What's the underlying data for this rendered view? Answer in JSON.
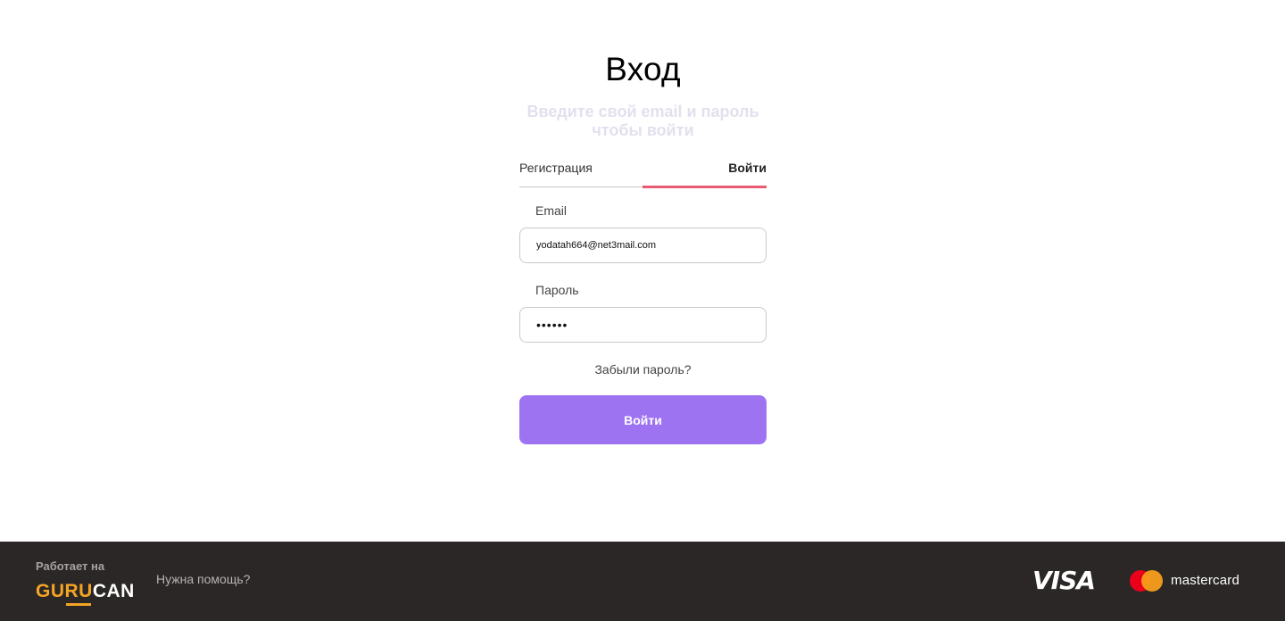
{
  "login": {
    "title": "Вход",
    "subtitle": "Введите свой email и пароль чтобы войти",
    "tabs": {
      "register": "Регистрация",
      "login": "Войти",
      "active": "login"
    },
    "email": {
      "label": "Email",
      "value": "yodatah664@net3mail.com"
    },
    "password": {
      "label": "Пароль",
      "value": "••••••"
    },
    "forgot_link": "Забыли пароль?",
    "submit_label": "Войти"
  },
  "footer": {
    "powered_by": "Работает на",
    "logo": {
      "part1": "GU",
      "part2": "RU",
      "part3": "CAN"
    },
    "help_link": "Нужна помощь?",
    "payment_visa": "VISA",
    "payment_mastercard": "mastercard"
  },
  "colors": {
    "accent": "#9d73f2",
    "tab_underline": "#e95a73",
    "footer_bg": "#2b2727",
    "logo_orange": "#f5a524"
  }
}
